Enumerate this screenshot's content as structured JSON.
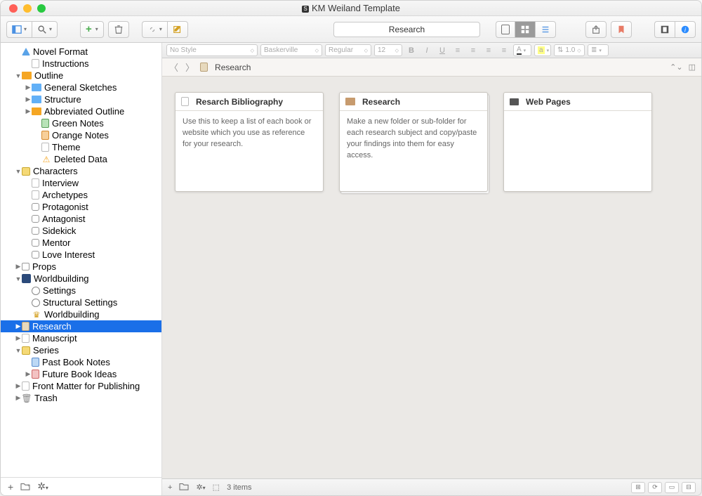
{
  "window": {
    "title": "KM Weiland Template"
  },
  "toolbar": {
    "search_value": "Research"
  },
  "format_bar": {
    "style": "No Style",
    "font": "Baskerville",
    "weight": "Regular",
    "size": "12",
    "line_spacing": "1.0"
  },
  "breadcrumb": {
    "label": "Research"
  },
  "sidebar": {
    "items": [
      {
        "label": "Novel Format",
        "depth": 1,
        "icon": "tri",
        "disc": ""
      },
      {
        "label": "Instructions",
        "depth": 2,
        "icon": "doc",
        "disc": ""
      },
      {
        "label": "Outline",
        "depth": 1,
        "icon": "fold-orange",
        "disc": "down"
      },
      {
        "label": "General Sketches",
        "depth": 2,
        "icon": "fold",
        "disc": "right"
      },
      {
        "label": "Structure",
        "depth": 2,
        "icon": "fold",
        "disc": "right"
      },
      {
        "label": "Abbreviated Outline",
        "depth": 2,
        "icon": "fold-orange",
        "disc": "right"
      },
      {
        "label": "Green Notes",
        "depth": 3,
        "icon": "green",
        "disc": ""
      },
      {
        "label": "Orange Notes",
        "depth": 3,
        "icon": "orangep",
        "disc": ""
      },
      {
        "label": "Theme",
        "depth": 3,
        "icon": "doc",
        "disc": ""
      },
      {
        "label": "Deleted Data",
        "depth": 3,
        "icon": "warn",
        "disc": ""
      },
      {
        "label": "Characters",
        "depth": 1,
        "icon": "char",
        "disc": "down"
      },
      {
        "label": "Interview",
        "depth": 2,
        "icon": "doc",
        "disc": ""
      },
      {
        "label": "Archetypes",
        "depth": 2,
        "icon": "doc",
        "disc": ""
      },
      {
        "label": "Protagonist",
        "depth": 2,
        "icon": "mask",
        "disc": ""
      },
      {
        "label": "Antagonist",
        "depth": 2,
        "icon": "mask",
        "disc": ""
      },
      {
        "label": "Sidekick",
        "depth": 2,
        "icon": "mask",
        "disc": ""
      },
      {
        "label": "Mentor",
        "depth": 2,
        "icon": "mask",
        "disc": ""
      },
      {
        "label": "Love Interest",
        "depth": 2,
        "icon": "mask",
        "disc": ""
      },
      {
        "label": "Props",
        "depth": 1,
        "icon": "box",
        "disc": "right"
      },
      {
        "label": "Worldbuilding",
        "depth": 1,
        "icon": "world",
        "disc": "down"
      },
      {
        "label": "Settings",
        "depth": 2,
        "icon": "globe",
        "disc": ""
      },
      {
        "label": "Structural Settings",
        "depth": 2,
        "icon": "globe",
        "disc": ""
      },
      {
        "label": "Worldbuilding",
        "depth": 2,
        "icon": "crown",
        "disc": ""
      },
      {
        "label": "Research",
        "depth": 1,
        "icon": "tan",
        "disc": "right",
        "selected": true
      },
      {
        "label": "Manuscript",
        "depth": 1,
        "icon": "doc",
        "disc": "right"
      },
      {
        "label": "Series",
        "depth": 1,
        "icon": "series",
        "disc": "down"
      },
      {
        "label": "Past Book Notes",
        "depth": 2,
        "icon": "blue",
        "disc": ""
      },
      {
        "label": "Future Book Ideas",
        "depth": 2,
        "icon": "red",
        "disc": "right"
      },
      {
        "label": "Front Matter for Publishing",
        "depth": 1,
        "icon": "doc",
        "disc": "right"
      },
      {
        "label": "Trash",
        "depth": 1,
        "icon": "trash",
        "disc": "right"
      }
    ]
  },
  "cards": [
    {
      "title": "Resarch Bibliography",
      "icon": "doc",
      "body": "Use this to keep a list of each book or website which you use as reference for your research.",
      "stack": false
    },
    {
      "title": "Research",
      "icon": "fold-brown",
      "body": "Make a new folder or sub-folder for each research subject and copy/paste your findings into them for easy access.",
      "stack": true
    },
    {
      "title": "Web Pages",
      "icon": "screen",
      "body": "",
      "stack": false
    }
  ],
  "footer": {
    "count_label": "3 items"
  }
}
